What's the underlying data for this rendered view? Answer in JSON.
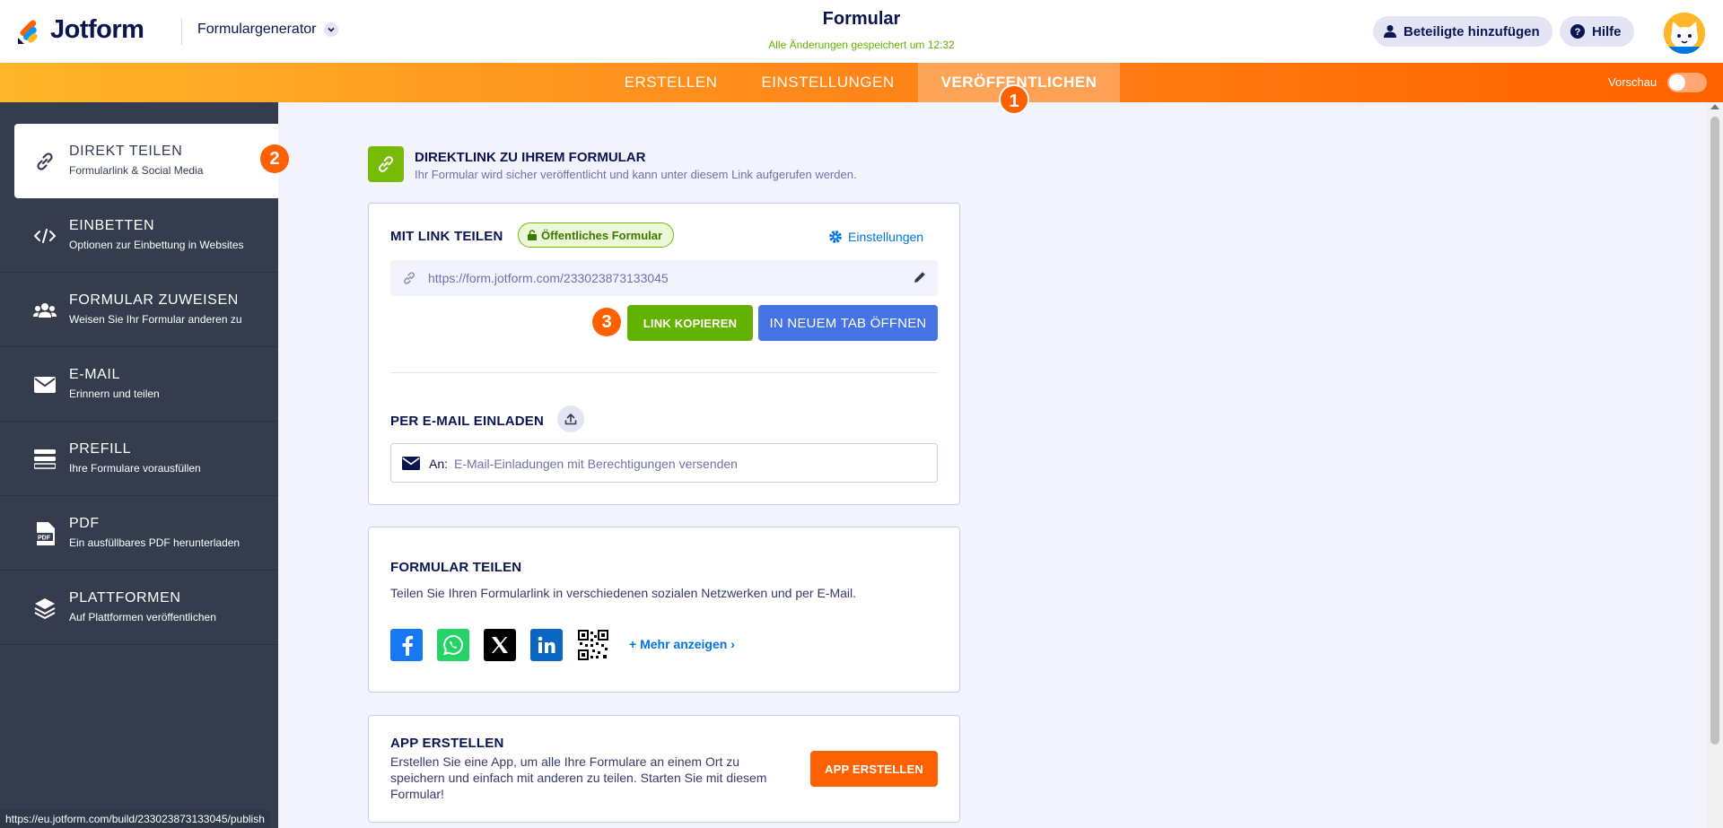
{
  "header": {
    "brand": "Jotform",
    "form_generator": "Formulargenerator",
    "form_title": "Formular",
    "saved_status": "Alle Änderungen gespeichert um 12:32",
    "add_participants": "Beteiligte hinzufügen",
    "help": "Hilfe"
  },
  "nav": {
    "tabs": [
      "ERSTELLEN",
      "EINSTELLUNGEN",
      "VERÖFFENTLICHEN"
    ],
    "active_tab": "VERÖFFENTLICHEN",
    "preview_label": "Vorschau"
  },
  "badges": [
    "1",
    "2",
    "3"
  ],
  "sidebar": {
    "items": [
      {
        "label": "DIREKT TEILEN",
        "sub": "Formularlink & Social Media",
        "icon": "link-icon"
      },
      {
        "label": "EINBETTEN",
        "sub": "Optionen zur Einbettung in Websites",
        "icon": "code-icon"
      },
      {
        "label": "FORMULAR ZUWEISEN",
        "sub": "Weisen Sie Ihr Formular anderen zu",
        "icon": "users-icon"
      },
      {
        "label": "E-MAIL",
        "sub": "Erinnern und teilen",
        "icon": "envelope-icon"
      },
      {
        "label": "PREFILL",
        "sub": "Ihre Formulare vorausfüllen",
        "icon": "prefill-icon"
      },
      {
        "label": "PDF",
        "sub": "Ein ausfüllbares PDF herunterladen",
        "icon": "pdf-icon"
      },
      {
        "label": "PLATTFORMEN",
        "sub": "Auf Plattformen veröffentlichen",
        "icon": "layers-icon"
      }
    ]
  },
  "direct": {
    "title": "DIREKTLINK ZU IHREM FORMULAR",
    "desc": "Ihr Formular wird sicher veröffentlicht und kann unter diesem Link aufgerufen werden."
  },
  "share_link": {
    "title": "MIT LINK TEILEN",
    "public_badge": "Öffentliches Formular",
    "settings": "Einstellungen",
    "url": "https://form.jotform.com/233023873133045",
    "copy_button": "LINK KOPIEREN",
    "newtab_button": "IN NEUEM TAB ÖFFNEN"
  },
  "email_invite": {
    "title": "PER E-MAIL EINLADEN",
    "to_label": "An:",
    "placeholder": "E-Mail-Einladungen mit Berechtigungen versenden"
  },
  "form_share": {
    "title": "FORMULAR TEILEN",
    "desc": "Teilen Sie Ihren Formularlink in verschiedenen sozialen Netzwerken und per E-Mail.",
    "more": "+ Mehr anzeigen ›"
  },
  "app": {
    "title": "APP ERSTELLEN",
    "desc": "Erstellen Sie eine App, um alle Ihre Formulare an einem Ort zu speichern und einfach mit anderen zu teilen. Starten Sie mit diesem Formular!",
    "button": "APP ERSTELLEN"
  },
  "status_bar": "https://eu.jotform.com/build/233023873133045/publish",
  "colors": {
    "orange": "#ff6100",
    "green": "#64b200",
    "blue": "#4573e3",
    "sidebar": "#343c4e",
    "navy": "#0a1551"
  }
}
